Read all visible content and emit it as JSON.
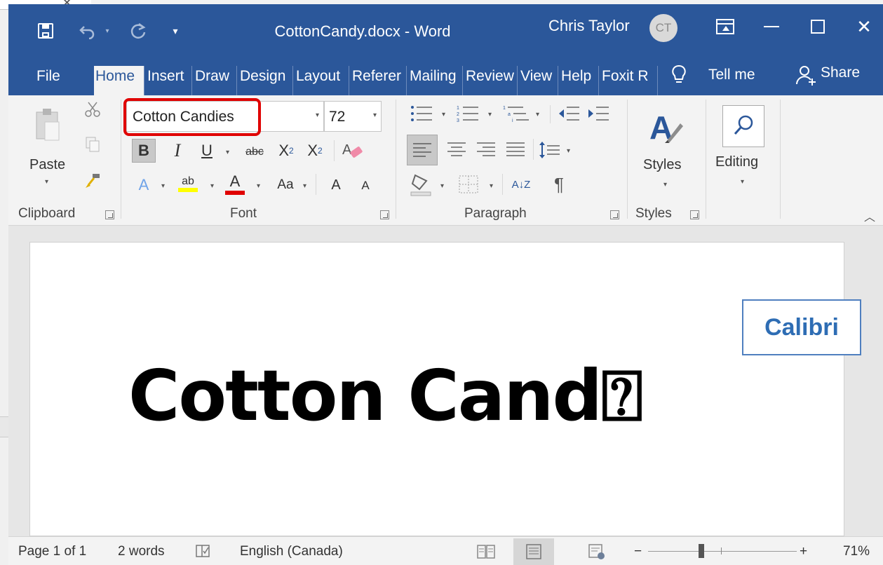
{
  "window": {
    "title": "CottonCandy.docx  -  Word",
    "user_name": "Chris Taylor",
    "user_initials": "CT",
    "accent_color": "#2b579a"
  },
  "quick_access": {
    "save": "save-icon",
    "undo": "undo-icon",
    "redo": "redo-icon",
    "customize": "▾"
  },
  "tabs": [
    {
      "label": "File",
      "active": false
    },
    {
      "label": "Home",
      "active": true
    },
    {
      "label": "Insert",
      "active": false
    },
    {
      "label": "Draw",
      "active": false
    },
    {
      "label": "Design",
      "active": false
    },
    {
      "label": "Layout",
      "active": false
    },
    {
      "label": "Referer",
      "active": false
    },
    {
      "label": "Mailing",
      "active": false
    },
    {
      "label": "Review",
      "active": false
    },
    {
      "label": "View",
      "active": false
    },
    {
      "label": "Help",
      "active": false
    },
    {
      "label": "Foxit R",
      "active": false
    }
  ],
  "tell_me": "Tell me",
  "share": "Share",
  "ribbon": {
    "clipboard": {
      "paste_label": "Paste",
      "group_label": "Clipboard"
    },
    "font": {
      "font_name": "Cotton Candies",
      "font_size": "72",
      "group_label": "Font",
      "bold": "B",
      "italic": "I",
      "underline": "U",
      "strikethrough": "abc",
      "subscript": "X",
      "subscript_mark": "2",
      "superscript": "X",
      "superscript_mark": "2",
      "text_effects": "A",
      "highlight": "ab",
      "font_color": "A",
      "change_case": "Aa",
      "grow_font": "A",
      "shrink_font": "A",
      "highlight_color": "#ffff00",
      "font_color_value": "#e00000",
      "ring_color": "#e00000"
    },
    "paragraph": {
      "group_label": "Paragraph",
      "sort": "A↓Z",
      "show_marks": "¶"
    },
    "styles": {
      "label": "Styles",
      "group_label": "Styles"
    },
    "editing": {
      "label": "Editing"
    }
  },
  "document": {
    "text": "Cotton Cand⍰",
    "callout": "Calibri",
    "callout_color": "#2e6db4"
  },
  "status": {
    "page": "Page 1 of 1",
    "words": "2 words",
    "language": "English (Canada)",
    "zoom": "71%",
    "zoom_minus": "−",
    "zoom_plus": "+"
  }
}
